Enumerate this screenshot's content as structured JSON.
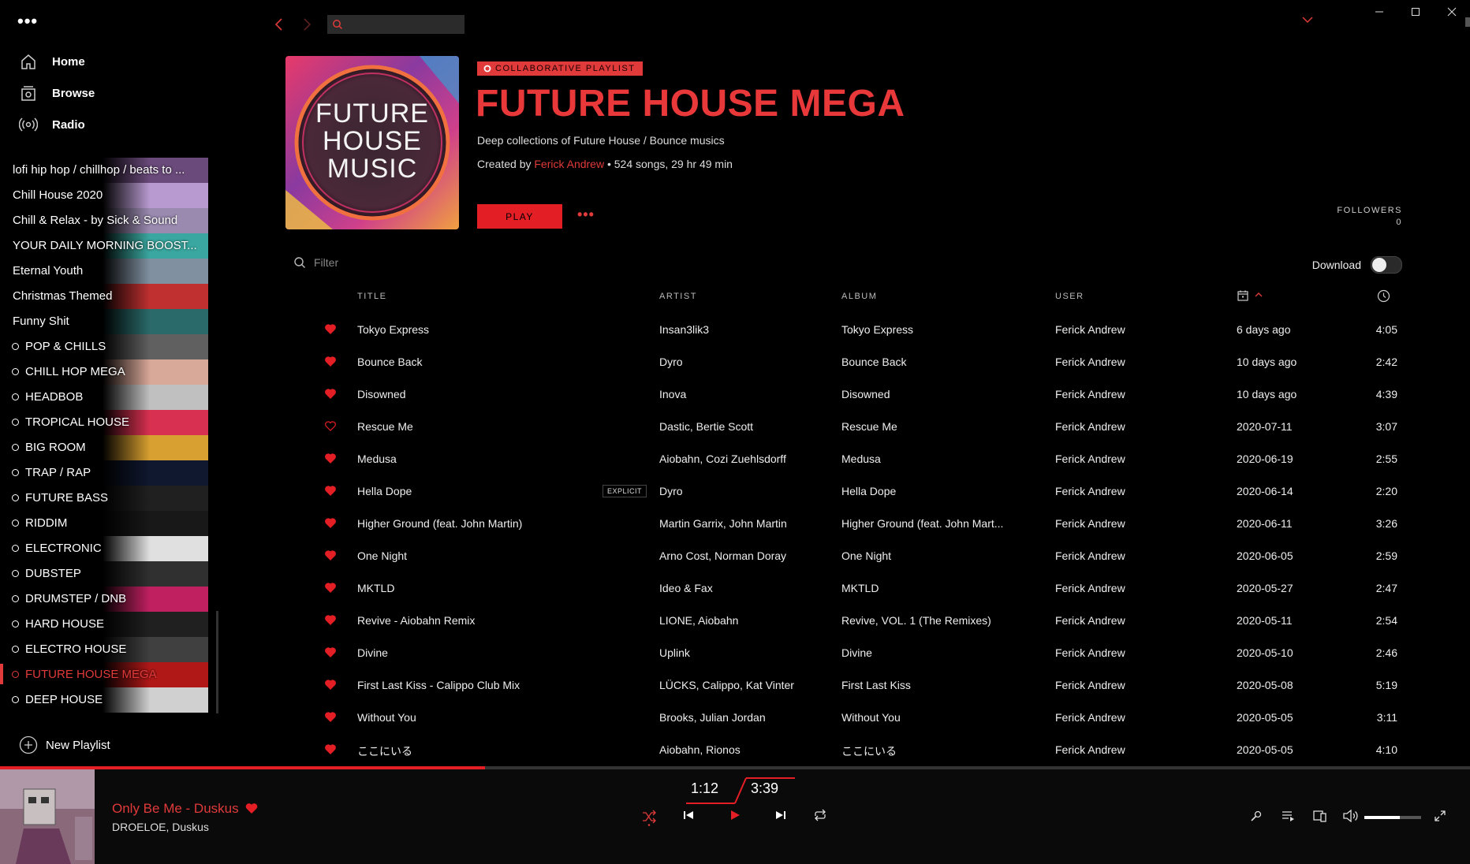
{
  "sidebar": {
    "menu_dots": "•••",
    "nav": [
      {
        "label": "Home",
        "icon": "home-icon"
      },
      {
        "label": "Browse",
        "icon": "browse-icon"
      },
      {
        "label": "Radio",
        "icon": "radio-icon"
      }
    ],
    "playlists": [
      {
        "label": "lofi hip hop / chillhop / beats to ...",
        "dot": false,
        "thumb_color": "#6a4a7a",
        "active": false
      },
      {
        "label": "Chill House 2020",
        "dot": false,
        "thumb_color": "#b89ad0",
        "active": false
      },
      {
        "label": "Chill & Relax - by Sick & Sound",
        "dot": false,
        "thumb_color": "#9a8ab0",
        "active": false
      },
      {
        "label": "YOUR DAILY MORNING BOOST...",
        "dot": false,
        "thumb_color": "#3aa8a0",
        "active": false
      },
      {
        "label": "Eternal Youth",
        "dot": false,
        "thumb_color": "#8090a0",
        "active": false
      },
      {
        "label": "Christmas Themed",
        "dot": false,
        "thumb_color": "#c03030",
        "active": false
      },
      {
        "label": "Funny Shit",
        "dot": false,
        "thumb_color": "#2a6a6a",
        "active": false
      },
      {
        "label": "POP & CHILLS",
        "dot": true,
        "thumb_color": "#606060",
        "active": false
      },
      {
        "label": "CHILL HOP MEGA",
        "dot": true,
        "thumb_color": "#d8a898",
        "active": false
      },
      {
        "label": "HEADBOB",
        "dot": true,
        "thumb_color": "#c0c0c0",
        "active": false
      },
      {
        "label": "TROPICAL HOUSE",
        "dot": true,
        "thumb_color": "#d83050",
        "active": false
      },
      {
        "label": "BIG ROOM",
        "dot": true,
        "thumb_color": "#d8a030",
        "active": false
      },
      {
        "label": "TRAP / RAP",
        "dot": true,
        "thumb_color": "#101830",
        "active": false
      },
      {
        "label": "FUTURE BASS",
        "dot": true,
        "thumb_color": "#202020",
        "active": false
      },
      {
        "label": "RIDDIM",
        "dot": true,
        "thumb_color": "#181818",
        "active": false
      },
      {
        "label": "ELECTRONIC",
        "dot": true,
        "thumb_color": "#e0e0e0",
        "active": false
      },
      {
        "label": "DUBSTEP",
        "dot": true,
        "thumb_color": "#303030",
        "active": false
      },
      {
        "label": "DRUMSTEP / DNB",
        "dot": true,
        "thumb_color": "#c02060",
        "active": false
      },
      {
        "label": "HARD HOUSE",
        "dot": true,
        "thumb_color": "#202020",
        "active": false
      },
      {
        "label": "ELECTRO HOUSE",
        "dot": true,
        "thumb_color": "#404040",
        "active": false
      },
      {
        "label": "FUTURE HOUSE MEGA",
        "dot": true,
        "thumb_color": "#b01818",
        "active": true
      },
      {
        "label": "DEEP HOUSE",
        "dot": true,
        "thumb_color": "#d0d0d0",
        "active": false
      }
    ],
    "new_playlist": "New Playlist"
  },
  "header": {
    "badge": "COLLABORATIVE PLAYLIST",
    "title": "FUTURE HOUSE MEGA",
    "cover_text": [
      "FUTURE",
      "HOUSE",
      "MUSIC"
    ],
    "description": "Deep collections of Future House / Bounce musics",
    "created_by_label": "Created by",
    "creator": "Ferick Andrew",
    "stats": "• 524 songs, 29 hr 49 min",
    "play_label": "PLAY",
    "more": "•••",
    "followers_label": "FOLLOWERS",
    "followers_count": "0"
  },
  "filter": {
    "placeholder": "Filter"
  },
  "download": {
    "label": "Download",
    "enabled": false
  },
  "table": {
    "columns": {
      "title": "TITLE",
      "artist": "ARTIST",
      "album": "ALBUM",
      "user": "USER"
    },
    "rows": [
      {
        "liked": true,
        "title": "Tokyo Express",
        "explicit": "",
        "artist": "Insan3lik3",
        "album": "Tokyo Express",
        "user": "Ferick Andrew",
        "added": "6 days ago",
        "duration": "4:05"
      },
      {
        "liked": true,
        "title": "Bounce Back",
        "explicit": "",
        "artist": "Dyro",
        "album": "Bounce Back",
        "user": "Ferick Andrew",
        "added": "10 days ago",
        "duration": "2:42"
      },
      {
        "liked": true,
        "title": "Disowned",
        "explicit": "",
        "artist": "Inova",
        "album": "Disowned",
        "user": "Ferick Andrew",
        "added": "10 days ago",
        "duration": "4:39"
      },
      {
        "liked": false,
        "title": "Rescue Me",
        "explicit": "",
        "artist": "Dastic, Bertie Scott",
        "album": "Rescue Me",
        "user": "Ferick Andrew",
        "added": "2020-07-11",
        "duration": "3:07"
      },
      {
        "liked": true,
        "title": "Medusa",
        "explicit": "",
        "artist": "Aiobahn, Cozi Zuehlsdorff",
        "album": "Medusa",
        "user": "Ferick Andrew",
        "added": "2020-06-19",
        "duration": "2:55"
      },
      {
        "liked": true,
        "title": "Hella Dope",
        "explicit": "EXPLICIT",
        "artist": "Dyro",
        "album": "Hella Dope",
        "user": "Ferick Andrew",
        "added": "2020-06-14",
        "duration": "2:20"
      },
      {
        "liked": true,
        "title": "Higher Ground (feat. John Martin)",
        "explicit": "",
        "artist": "Martin Garrix, John Martin",
        "album": "Higher Ground (feat. John Mart...",
        "user": "Ferick Andrew",
        "added": "2020-06-11",
        "duration": "3:26"
      },
      {
        "liked": true,
        "title": "One Night",
        "explicit": "",
        "artist": "Arno Cost, Norman Doray",
        "album": "One Night",
        "user": "Ferick Andrew",
        "added": "2020-06-05",
        "duration": "2:59"
      },
      {
        "liked": true,
        "title": "MKTLD",
        "explicit": "",
        "artist": "Ideo & Fax",
        "album": "MKTLD",
        "user": "Ferick Andrew",
        "added": "2020-05-27",
        "duration": "2:47"
      },
      {
        "liked": true,
        "title": "Revive - Aiobahn Remix",
        "explicit": "",
        "artist": "LIONE, Aiobahn",
        "album": "Revive, VOL. 1 (The Remixes)",
        "user": "Ferick Andrew",
        "added": "2020-05-11",
        "duration": "2:54"
      },
      {
        "liked": true,
        "title": "Divine",
        "explicit": "",
        "artist": "Uplink",
        "album": "Divine",
        "user": "Ferick Andrew",
        "added": "2020-05-10",
        "duration": "2:46"
      },
      {
        "liked": true,
        "title": "First Last Kiss - Calippo Club Mix",
        "explicit": "",
        "artist": "LÜCKS, Calippo, Kat Vinter",
        "album": "First Last Kiss",
        "user": "Ferick Andrew",
        "added": "2020-05-08",
        "duration": "5:19"
      },
      {
        "liked": true,
        "title": "Without You",
        "explicit": "",
        "artist": "Brooks, Julian Jordan",
        "album": "Without You",
        "user": "Ferick Andrew",
        "added": "2020-05-05",
        "duration": "3:11"
      },
      {
        "liked": true,
        "title": "ここにいる",
        "explicit": "",
        "artist": "Aiobahn, Rionos",
        "album": "ここにいる",
        "user": "Ferick Andrew",
        "added": "2020-05-05",
        "duration": "4:10"
      }
    ]
  },
  "player": {
    "track": "Only Be Me - Duskus",
    "artist": "DROELOE, Duskus",
    "current_time": "1:12",
    "total_time": "3:39",
    "progress": 0.33,
    "volume": 0.62
  },
  "colors": {
    "accent": "#e31e24",
    "background": "#000000"
  }
}
